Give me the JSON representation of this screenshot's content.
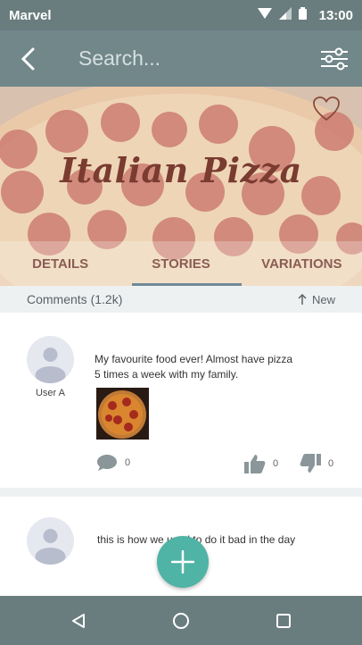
{
  "status_bar": {
    "carrier": "Marvel",
    "time": "13:00"
  },
  "app_bar": {
    "search_placeholder": "Search..."
  },
  "hero": {
    "title": "Italian Pizza"
  },
  "tabs": [
    {
      "label": "DETAILS",
      "active": false
    },
    {
      "label": "STORIES",
      "active": true
    },
    {
      "label": "VARIATIONS",
      "active": false
    }
  ],
  "comments_bar": {
    "count": "Comments (1.2k)",
    "sort": "New"
  },
  "comments": [
    {
      "user": "User A",
      "text": "My favourite food ever! Almost have pizza 5 times a week with my family.",
      "replies": "0",
      "likes": "0",
      "dislikes": "0"
    },
    {
      "user": "",
      "text": "this is how we used to do it bad in the day"
    }
  ],
  "colors": {
    "accent": "#4fb3a5",
    "app_bar": "#71878a",
    "title": "#7a3b30"
  }
}
